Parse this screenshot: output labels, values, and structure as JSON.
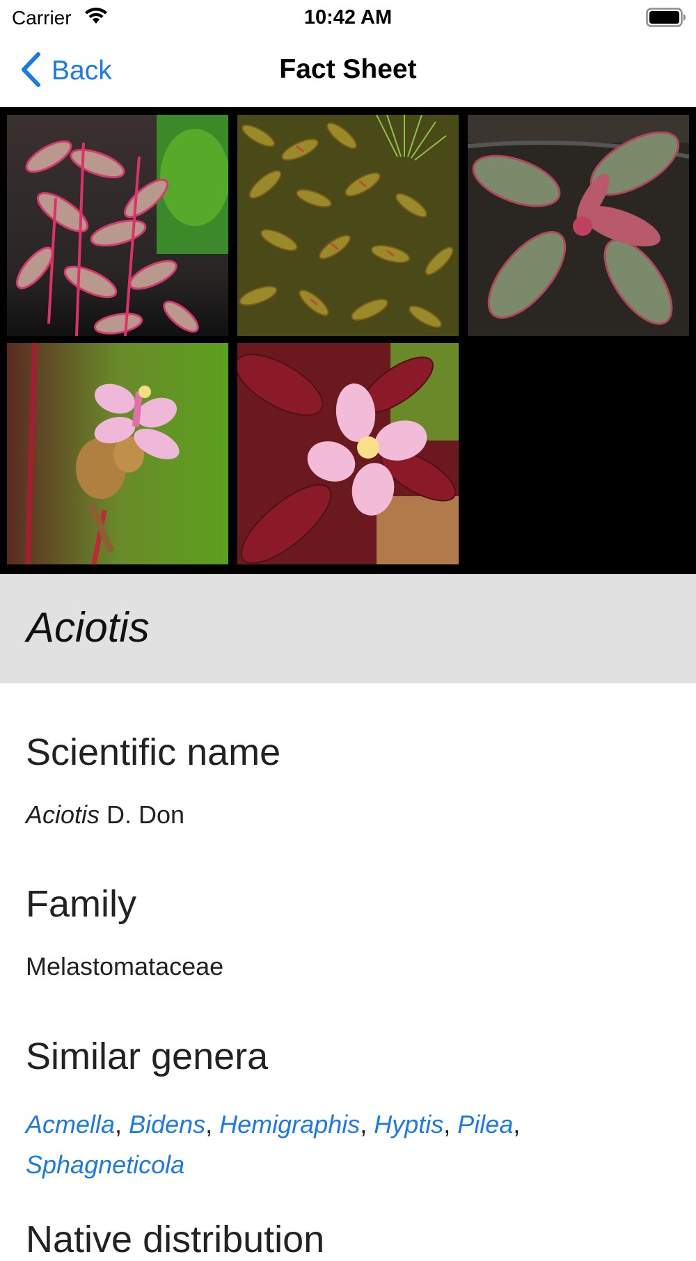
{
  "status_bar": {
    "carrier": "Carrier",
    "time": "10:42 AM",
    "icons": [
      "wifi-icon",
      "battery-icon"
    ]
  },
  "nav": {
    "back_label": "Back",
    "title": "Fact Sheet",
    "back_icon": "chevron-left-icon"
  },
  "genus": {
    "title": "Aciotis"
  },
  "sections": {
    "scientific_name": {
      "heading": "Scientific name",
      "genus": "Aciotis",
      "author": " D. Don"
    },
    "family": {
      "heading": "Family",
      "value": "Melastomataceae"
    },
    "similar_genera": {
      "heading": "Similar genera",
      "links": [
        "Acmella",
        "Bidens",
        "Hemigraphis",
        "Hyptis",
        "Pilea",
        "Sphagneticola"
      ]
    },
    "native_distribution": {
      "heading": "Native distribution"
    }
  },
  "colors": {
    "accent": "#1a7ae8",
    "title_band": "#e1e1e1",
    "gallery_bg": "#000000"
  }
}
